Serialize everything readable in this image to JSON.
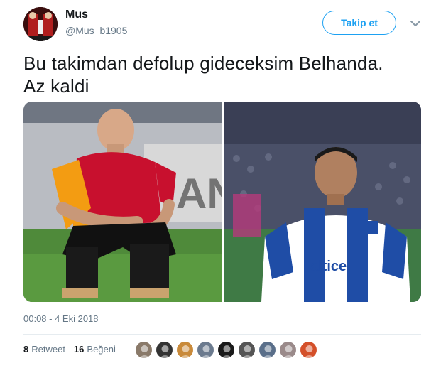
{
  "author": {
    "name": "Mus",
    "handle": "@Mus_b1905"
  },
  "follow_label": "Takip et",
  "tweet_text_line1": "Bu takimdan defolup gideceksim Belhanda.",
  "tweet_text_line2": "Az kaldi",
  "timestamp": "00:08 - 4 Eki 2018",
  "stats": {
    "retweets_count": "8",
    "retweets_label": "Retweet",
    "likes_count": "16",
    "likes_label": "Beğeni"
  },
  "colors": {
    "accent": "#1da1f2",
    "muted": "#657786",
    "text": "#14171a"
  },
  "likers": [
    {
      "icon": "liker-avatar-1",
      "color": "#8a7a6a"
    },
    {
      "icon": "liker-avatar-2",
      "color": "#333333"
    },
    {
      "icon": "liker-avatar-3",
      "color": "#c98a3a"
    },
    {
      "icon": "liker-avatar-4",
      "color": "#6b7a8e"
    },
    {
      "icon": "liker-avatar-5",
      "color": "#1a1a1a"
    },
    {
      "icon": "liker-avatar-6",
      "color": "#555555"
    },
    {
      "icon": "liker-avatar-7",
      "color": "#5a6f8a"
    },
    {
      "icon": "liker-avatar-8",
      "color": "#9a8a8a"
    },
    {
      "icon": "liker-avatar-9",
      "color": "#d4502a"
    }
  ]
}
